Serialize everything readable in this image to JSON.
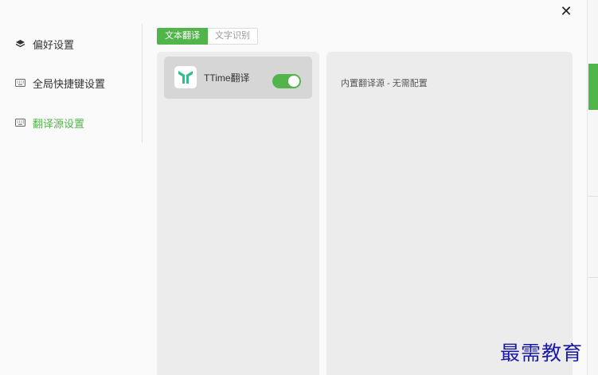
{
  "dialog": {
    "close_symbol": "✕"
  },
  "sidebar": {
    "items": [
      {
        "label": "偏好设置",
        "icon": "layers-icon",
        "active": false
      },
      {
        "label": "全局快捷键设置",
        "icon": "keyboard-icon",
        "active": false
      },
      {
        "label": "翻译源设置",
        "icon": "keyboard-icon",
        "active": true
      }
    ]
  },
  "tabs": [
    {
      "label": "文本翻译",
      "active": true
    },
    {
      "label": "文字识别",
      "active": false
    }
  ],
  "sources": [
    {
      "name": "TTime翻译",
      "enabled": true
    }
  ],
  "detail": {
    "text": "内置翻译源 - 无需配置"
  },
  "watermark": {
    "text": "最需教育"
  },
  "colors": {
    "accent": "#52b54b",
    "panel_bg": "#ececec",
    "card_selected": "#d6d6d6",
    "watermark": "#1a1aa6"
  }
}
